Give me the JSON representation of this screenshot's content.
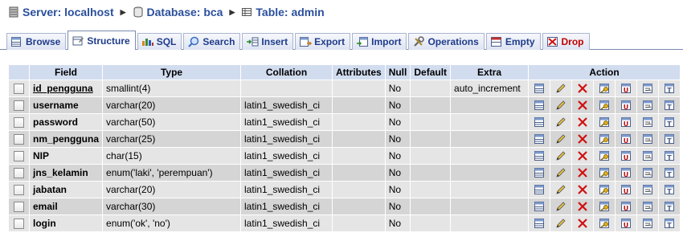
{
  "breadcrumb": {
    "server": "Server: localhost",
    "database": "Database: bca",
    "table": "Table: admin",
    "separator": "▶"
  },
  "tabs": [
    {
      "label": "Browse",
      "icon": "browse-icon"
    },
    {
      "label": "Structure",
      "icon": "structure-icon",
      "active": true
    },
    {
      "label": "SQL",
      "icon": "sql-icon"
    },
    {
      "label": "Search",
      "icon": "search-icon"
    },
    {
      "label": "Insert",
      "icon": "insert-icon"
    },
    {
      "label": "Export",
      "icon": "export-icon"
    },
    {
      "label": "Import",
      "icon": "import-icon"
    },
    {
      "label": "Operations",
      "icon": "operations-icon"
    },
    {
      "label": "Empty",
      "icon": "empty-icon"
    },
    {
      "label": "Drop",
      "icon": "drop-icon"
    }
  ],
  "table": {
    "headers": {
      "field": "Field",
      "type": "Type",
      "collation": "Collation",
      "attributes": "Attributes",
      "null": "Null",
      "default": "Default",
      "extra": "Extra",
      "action": "Action"
    },
    "rows": [
      {
        "field": "id_pengguna",
        "type": "smallint(4)",
        "collation": "",
        "attributes": "",
        "null": "No",
        "default": "",
        "extra": "auto_increment",
        "primary": true
      },
      {
        "field": "username",
        "type": "varchar(20)",
        "collation": "latin1_swedish_ci",
        "attributes": "",
        "null": "No",
        "default": "",
        "extra": ""
      },
      {
        "field": "password",
        "type": "varchar(50)",
        "collation": "latin1_swedish_ci",
        "attributes": "",
        "null": "No",
        "default": "",
        "extra": ""
      },
      {
        "field": "nm_pengguna",
        "type": "varchar(25)",
        "collation": "latin1_swedish_ci",
        "attributes": "",
        "null": "No",
        "default": "",
        "extra": ""
      },
      {
        "field": "NIP",
        "type": "char(15)",
        "collation": "latin1_swedish_ci",
        "attributes": "",
        "null": "No",
        "default": "",
        "extra": ""
      },
      {
        "field": "jns_kelamin",
        "type": "enum('laki', 'perempuan')",
        "collation": "latin1_swedish_ci",
        "attributes": "",
        "null": "No",
        "default": "",
        "extra": ""
      },
      {
        "field": "jabatan",
        "type": "varchar(20)",
        "collation": "latin1_swedish_ci",
        "attributes": "",
        "null": "No",
        "default": "",
        "extra": ""
      },
      {
        "field": "email",
        "type": "varchar(30)",
        "collation": "latin1_swedish_ci",
        "attributes": "",
        "null": "No",
        "default": "",
        "extra": ""
      },
      {
        "field": "login",
        "type": "enum('ok', 'no')",
        "collation": "latin1_swedish_ci",
        "attributes": "",
        "null": "No",
        "default": "",
        "extra": ""
      }
    ],
    "actions": [
      "browse-distinct-icon",
      "edit-icon",
      "drop-icon",
      "primary-key-icon",
      "unique-icon",
      "index-icon",
      "fulltext-icon"
    ]
  },
  "colors": {
    "link": "#2a4f9c",
    "header_bg": "#d1dcef",
    "row_odd": "#e5e5e5",
    "row_even": "#d5d5d5",
    "drop_red": "#c00000"
  }
}
